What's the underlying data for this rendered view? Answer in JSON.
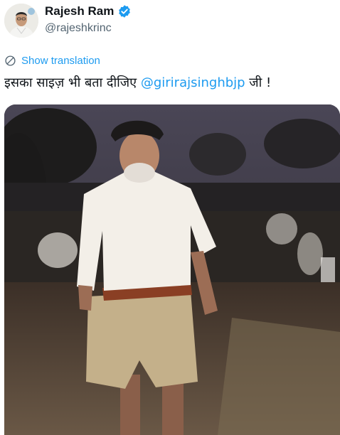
{
  "author": {
    "display_name": "Rajesh Ram",
    "handle": "@rajeshkrinc",
    "verified": true,
    "verified_color": "#1d9bf0"
  },
  "translation": {
    "label": "Show translation",
    "icon": "translate-icon"
  },
  "tweet": {
    "text_before": "इसका साइज़ भी बता दीजिए ",
    "mention": "@girirajsinghbjp",
    "text_after": " जी !"
  },
  "colors": {
    "link": "#1d9bf0",
    "text_primary": "#0f1419",
    "text_secondary": "#536471"
  }
}
